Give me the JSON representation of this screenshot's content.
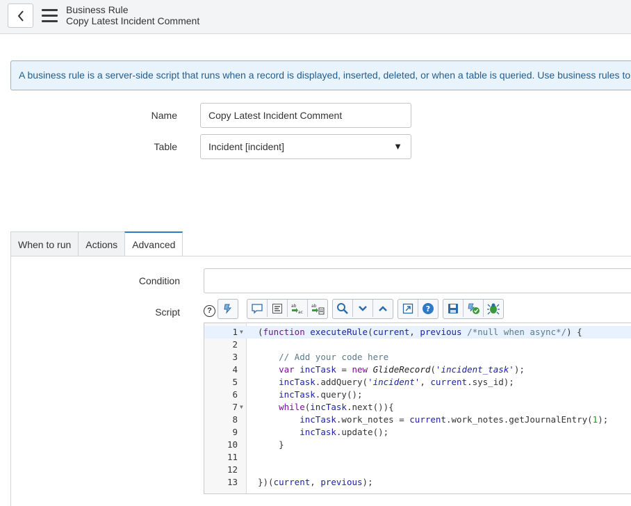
{
  "header": {
    "title": "Business Rule",
    "subtitle": "Copy Latest Incident Comment"
  },
  "info_text": "A business rule is a server-side script that runs when a record is displayed, inserted, deleted, or when a table is queried. Use business rules to auto",
  "form": {
    "name_label": "Name",
    "name_value": "Copy Latest Incident Comment",
    "table_label": "Table",
    "table_value": "Incident [incident]",
    "condition_label": "Condition",
    "condition_value": "",
    "script_label": "Script"
  },
  "tabs": [
    {
      "label": "When to run",
      "active": false
    },
    {
      "label": "Actions",
      "active": false
    },
    {
      "label": "Advanced",
      "active": true
    }
  ],
  "toolbar": {
    "groups": [
      [
        "format-script-icon"
      ],
      [
        "comment-icon",
        "format-code-icon",
        "replace-icon",
        "replace-all-icon"
      ],
      [
        "search-icon",
        "find-next-icon",
        "find-previous-icon"
      ],
      [
        "fullscreen-icon",
        "help-icon"
      ],
      [
        "save-icon",
        "check-syntax-icon",
        "script-debugger-icon"
      ]
    ],
    "help_glyph": "?"
  },
  "code_lines": [
    {
      "n": "1",
      "fold": true,
      "text": "(function executeRule(current, previous /*null when async*/) {"
    },
    {
      "n": "2",
      "fold": false,
      "text": ""
    },
    {
      "n": "3",
      "fold": false,
      "text": "    // Add your code here"
    },
    {
      "n": "4",
      "fold": false,
      "text": "    var incTask = new GlideRecord('incident_task');"
    },
    {
      "n": "5",
      "fold": false,
      "text": "    incTask.addQuery('incident', current.sys_id);"
    },
    {
      "n": "6",
      "fold": false,
      "text": "    incTask.query();"
    },
    {
      "n": "7",
      "fold": true,
      "text": "    while(incTask.next()){"
    },
    {
      "n": "8",
      "fold": false,
      "text": "        incTask.work_notes = current.work_notes.getJournalEntry(1);"
    },
    {
      "n": "9",
      "fold": false,
      "text": "        incTask.update();"
    },
    {
      "n": "10",
      "fold": false,
      "text": "    }"
    },
    {
      "n": "11",
      "fold": false,
      "text": ""
    },
    {
      "n": "12",
      "fold": false,
      "text": ""
    },
    {
      "n": "13",
      "fold": false,
      "text": "})(current, previous);"
    }
  ],
  "colors": {
    "accent": "#2c7ac8",
    "info_bg": "#e8f3fc",
    "info_border": "#7dbbe8"
  }
}
